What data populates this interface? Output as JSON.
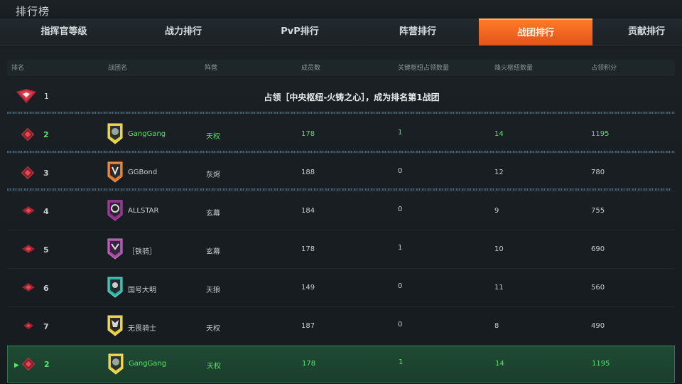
{
  "header": {
    "title": "排行榜"
  },
  "tabs": [
    {
      "label": "指挥官等级"
    },
    {
      "label": "战力排行"
    },
    {
      "label": "PvP排行"
    },
    {
      "label": "阵营排行"
    },
    {
      "label": "战团排行",
      "active": true
    },
    {
      "label": "贡献排行"
    }
  ],
  "columns": [
    "排名",
    "战团名",
    "阵营",
    "成员数",
    "关键枢纽占领数量",
    "烽火枢纽数量",
    "占领积分"
  ],
  "banner": {
    "rank": "1",
    "text": "占领［中央枢纽-火铸之心］，成为排名第1战团"
  },
  "rows": [
    {
      "rank": "2",
      "name": "GangGang",
      "faction": "天权",
      "members": "178",
      "key_hubs": "1",
      "beacon_hubs": "14",
      "score": "1195",
      "highlight": true
    },
    {
      "rank": "3",
      "name": "GGBond",
      "faction": "灰烬",
      "members": "188",
      "key_hubs": "0",
      "beacon_hubs": "12",
      "score": "780"
    },
    {
      "rank": "4",
      "name": "ALLSTAR",
      "faction": "玄幕",
      "members": "184",
      "key_hubs": "0",
      "beacon_hubs": "9",
      "score": "755"
    },
    {
      "rank": "5",
      "name": "［铁骑］",
      "faction": "玄幕",
      "members": "178",
      "key_hubs": "1",
      "beacon_hubs": "10",
      "score": "690"
    },
    {
      "rank": "6",
      "name": "国号大明",
      "faction": "天狼",
      "members": "149",
      "key_hubs": "0",
      "beacon_hubs": "11",
      "score": "560"
    },
    {
      "rank": "7",
      "name": "无畏骑士",
      "faction": "天权",
      "members": "187",
      "key_hubs": "0",
      "beacon_hubs": "8",
      "score": "490"
    }
  ],
  "my_row": {
    "rank": "2",
    "name": "GangGang",
    "faction": "天权",
    "members": "178",
    "key_hubs": "1",
    "beacon_hubs": "14",
    "score": "1195"
  },
  "colors": {
    "accent": "#ff6a1f",
    "highlight_green": "#58e26a",
    "my_row_bg": "#1f4a34"
  },
  "icons": [
    "rank-diamond-icon",
    "guild-emblem-icon",
    "current-player-arrow-icon"
  ]
}
